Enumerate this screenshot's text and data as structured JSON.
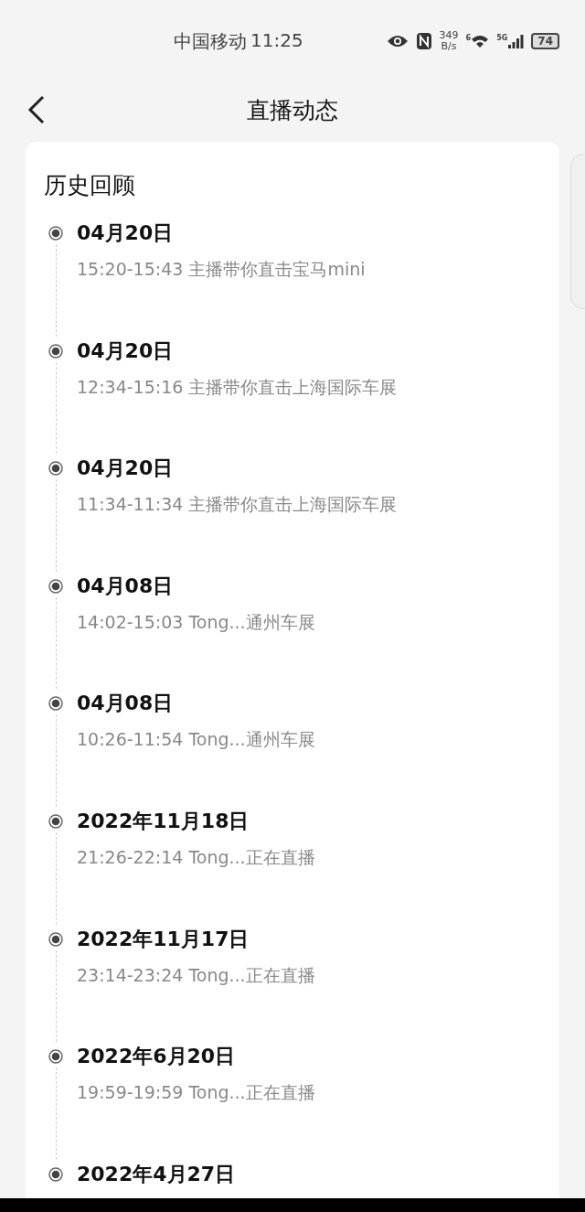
{
  "status_bar": {
    "carrier": "中国移动",
    "time": "11:25",
    "speed_value": "349",
    "speed_unit": "B/s",
    "wifi_badge": "6",
    "network": "5G",
    "battery": "74"
  },
  "header": {
    "title": "直播动态"
  },
  "section": {
    "title": "历史回顾",
    "items": [
      {
        "date": "04月20日",
        "detail": "15:20-15:43 主播带你直击宝马mini"
      },
      {
        "date": "04月20日",
        "detail": "12:34-15:16 主播带你直击上海国际车展"
      },
      {
        "date": "04月20日",
        "detail": "11:34-11:34 主播带你直击上海国际车展"
      },
      {
        "date": "04月08日",
        "detail": "14:02-15:03 Tong...通州车展"
      },
      {
        "date": "04月08日",
        "detail": "10:26-11:54 Tong...通州车展"
      },
      {
        "date": "2022年11月18日",
        "detail": "21:26-22:14 Tong...正在直播"
      },
      {
        "date": "2022年11月17日",
        "detail": "23:14-23:24 Tong...正在直播"
      },
      {
        "date": "2022年6月20日",
        "detail": "19:59-19:59 Tong...正在直播"
      },
      {
        "date": "2022年4月27日"
      }
    ]
  }
}
